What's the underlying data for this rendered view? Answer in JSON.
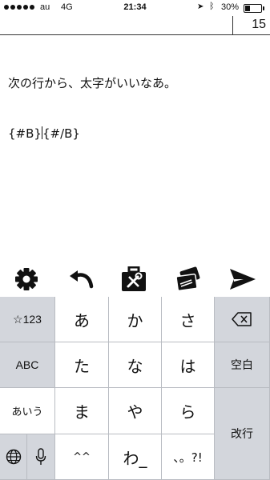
{
  "status_bar": {
    "carrier": "au",
    "network": "4G",
    "time": "21:34",
    "battery_percent": "30%",
    "battery_level": 0.3,
    "icons": [
      "signal-dots",
      "location-arrow-icon",
      "bluetooth-icon",
      "battery-icon"
    ]
  },
  "header": {
    "counter": "15"
  },
  "editor": {
    "line1": "次の行から、太字がいいなあ。",
    "line2_before_caret": "{#B}",
    "line2_after_caret": "{#/B}"
  },
  "toolbar": {
    "icons": [
      "gear-icon",
      "undo-icon",
      "toolbox-icon",
      "cards-icon",
      "send-icon"
    ]
  },
  "keyboard": {
    "left_column": {
      "symbols": "☆123",
      "alphabet": "ABC",
      "kana": "あいう",
      "globe_icon": "globe-icon",
      "mic_icon": "microphone-icon"
    },
    "keys": {
      "a": "あ",
      "ka": "か",
      "sa": "さ",
      "ta": "た",
      "na": "な",
      "ha": "は",
      "ma": "ま",
      "ya": "や",
      "ra": "ら",
      "modifier": "^^",
      "wa": "わ_",
      "punct": "、。?!"
    },
    "right_column": {
      "delete_icon": "delete-icon",
      "space": "空白",
      "return": "改行"
    }
  },
  "colors": {
    "keyboard_bg": "#d3d6dc",
    "key_light": "#ffffff",
    "text": "#111111"
  }
}
